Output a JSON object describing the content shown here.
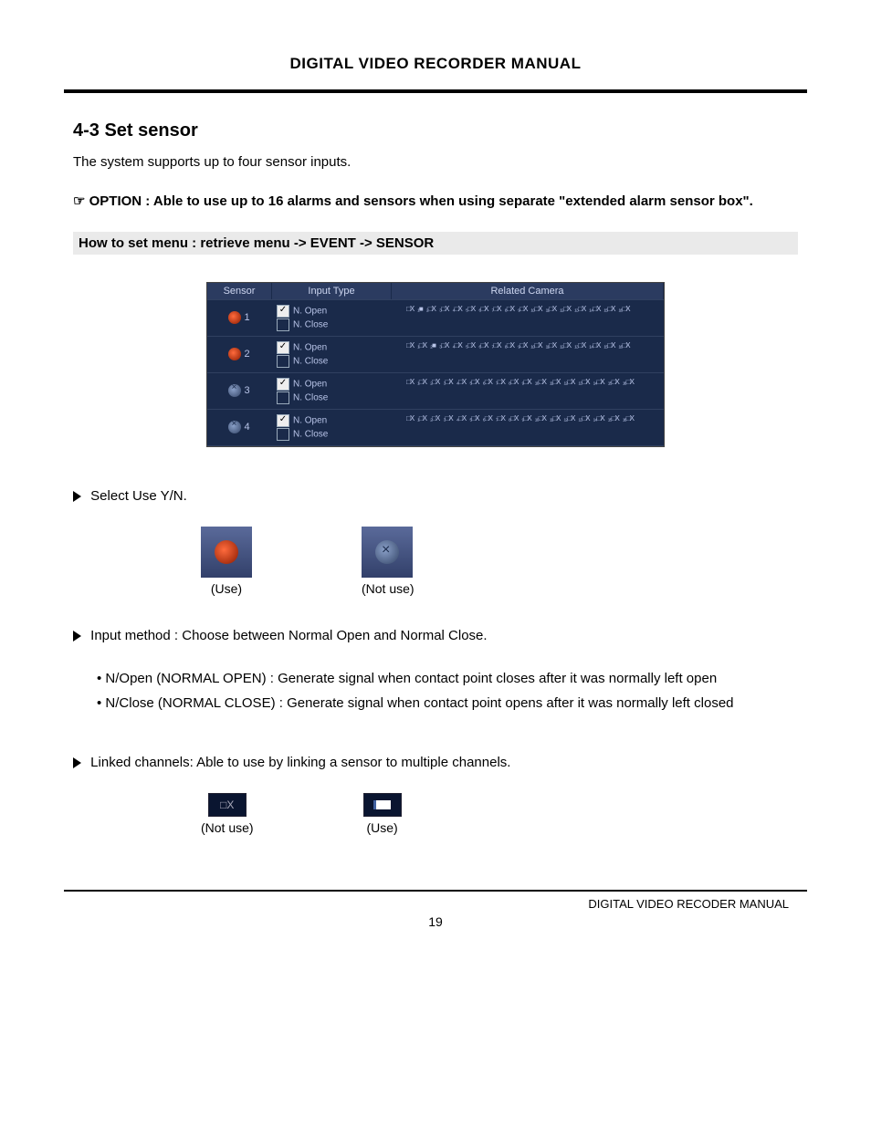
{
  "header": {
    "title": "DIGITAL VIDEO RECORDER MANUAL"
  },
  "section": {
    "heading": "4-3 Set sensor",
    "intro": "The system supports up to four sensor inputs.",
    "option_prefix": "☞ OPTION : ",
    "option_text": "Able to use up to 16 alarms and sensors when using separate \"extended alarm sensor box\".",
    "howto": "How to set menu : retrieve menu -> EVENT -> SENSOR"
  },
  "dvr": {
    "cols": {
      "sensor": "Sensor",
      "input": "Input Type",
      "camera": "Related Camera"
    },
    "input_open": "N. Open",
    "input_close": "N. Close",
    "rows": [
      {
        "num": "1",
        "active": true
      },
      {
        "num": "2",
        "active": true
      },
      {
        "num": "3",
        "active": false
      },
      {
        "num": "4",
        "active": false
      }
    ]
  },
  "bullets": {
    "select_use": "Select Use Y/N.",
    "use_label": "(Use)",
    "notuse_label": "(Not use)",
    "input_method": "Input method : Choose between Normal Open and Normal Close.",
    "nopen": "• N/Open (NORMAL OPEN) : Generate signal when contact point closes after it was normally left open",
    "nclose": "• N/Close (NORMAL CLOSE) : Generate signal when contact point opens after it was normally left closed",
    "linked": "Linked channels: Able to use by linking a sensor to multiple channels."
  },
  "footer": {
    "text": "DIGITAL VIDEO RECODER MANUAL",
    "page": "19"
  }
}
